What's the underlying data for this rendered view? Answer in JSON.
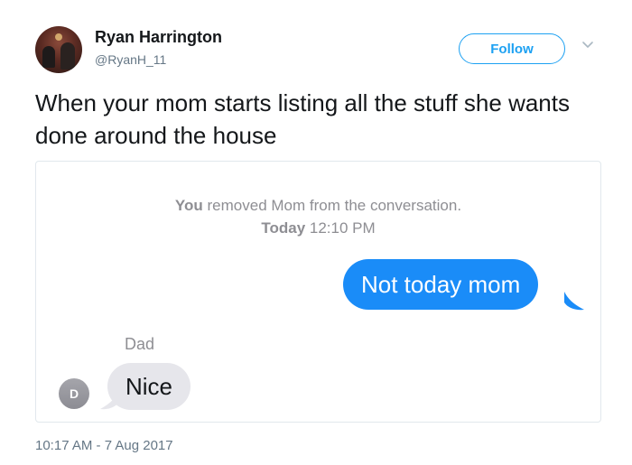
{
  "tweet": {
    "author_name": "Ryan Harrington",
    "author_handle": "@RyanH_11",
    "follow_label": "Follow",
    "text": "When your mom starts listing all the stuff she wants done around the house",
    "timestamp": "10:17 AM - 7 Aug 2017"
  },
  "screenshot": {
    "system_line1_bold": "You",
    "system_line1_rest": " removed Mom from the conversation.",
    "system_line2_bold": "Today",
    "system_line2_rest": " 12:10 PM",
    "outgoing_message": "Not today mom",
    "incoming_sender": "Dad",
    "incoming_sender_initial": "D",
    "incoming_message": "Nice"
  },
  "colors": {
    "accent": "#1da1f2",
    "imessage_blue": "#1a8cf8",
    "incoming_bubble": "#e6e6eb"
  },
  "icons": [
    "chevron-down-icon"
  ]
}
